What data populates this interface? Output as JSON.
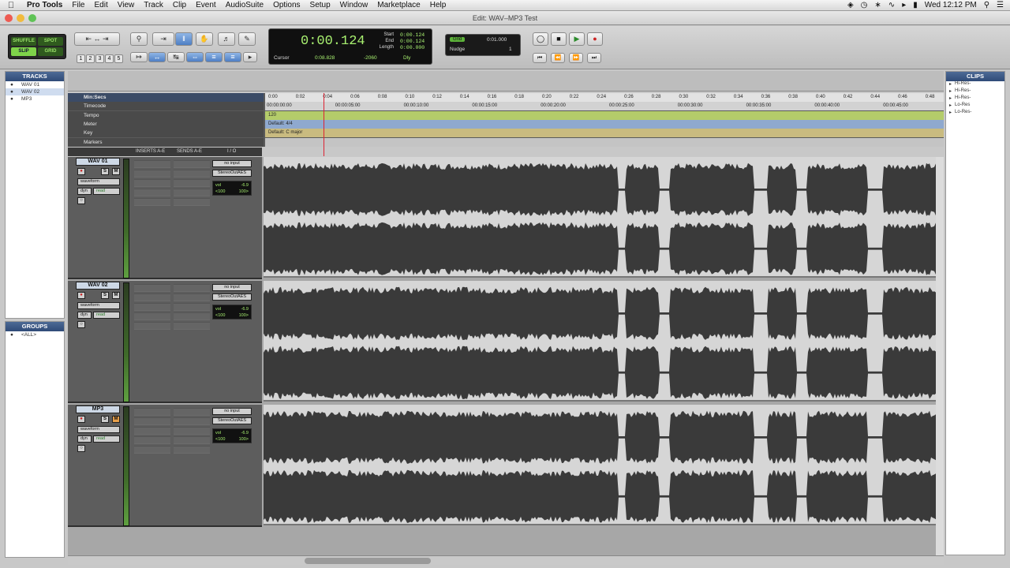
{
  "menubar": {
    "app": "Pro Tools",
    "items": [
      "File",
      "Edit",
      "View",
      "Track",
      "Clip",
      "Event",
      "AudioSuite",
      "Options",
      "Setup",
      "Window",
      "Marketplace",
      "Help"
    ],
    "clock": "Wed 12:12 PM"
  },
  "window": {
    "title": "Edit: WAV–MP3 Test"
  },
  "modes": {
    "shuffle": "SHUFFLE",
    "spot": "SPOT",
    "slip": "SLIP",
    "grid": "GRID"
  },
  "zoom_presets": [
    "1",
    "2",
    "3",
    "4",
    "5"
  ],
  "counter": {
    "main": "0:00.124",
    "start_label": "Start",
    "end_label": "End",
    "length_label": "Length",
    "start": "0:00.124",
    "end": "0:00.124",
    "length": "0:00.000",
    "cursor_label": "Cursor",
    "cursor": "0:08.828",
    "cursor_db": "-2060",
    "dly": "Dly"
  },
  "grid_nudge": {
    "grid_label": "Grid",
    "grid_value": "0:01.000",
    "nudge_label": "Nudge",
    "nudge_value": "1"
  },
  "tracks_panel": {
    "header": "TRACKS",
    "items": [
      {
        "name": "WAV 01"
      },
      {
        "name": "WAV 02"
      },
      {
        "name": "MP3"
      }
    ]
  },
  "groups_panel": {
    "header": "GROUPS",
    "items": [
      {
        "name": "<ALL>"
      }
    ]
  },
  "clips_panel": {
    "header": "CLIPS",
    "items": [
      "Hi-Res-",
      "Hi-Res-",
      "Hi-Res-",
      "Lo-Res",
      "Lo-Res-"
    ]
  },
  "rulers": {
    "minsecs": "Min:Secs",
    "timecode": "Timecode",
    "tempo": "Tempo",
    "meter": "Meter",
    "key": "Key",
    "markers": "Markers",
    "tempo_value": "120",
    "meter_value": "Default: 4/4",
    "key_value": "Default: C major",
    "minsecs_ticks": [
      "0:00",
      "0:02",
      "0:04",
      "0:06",
      "0:08",
      "0:10",
      "0:12",
      "0:14",
      "0:16",
      "0:18",
      "0:20",
      "0:22",
      "0:24",
      "0:26",
      "0:28",
      "0:30",
      "0:32",
      "0:34",
      "0:36",
      "0:38",
      "0:40",
      "0:42",
      "0:44",
      "0:46",
      "0:48"
    ],
    "timecode_ticks": [
      "00:00:00:00",
      "00:00:05:00",
      "00:00:10:00",
      "00:00:15:00",
      "00:00:20:00",
      "00:00:25:00",
      "00:00:30:00",
      "00:00:35:00",
      "00:00:40:00",
      "00:00:45:00"
    ]
  },
  "column_headers": {
    "inserts": "INSERTS A-E",
    "sends": "SENDS A-E",
    "io": "I / O"
  },
  "track_list": [
    {
      "name": "WAV 01",
      "view": "waveform",
      "dyn": "dyn",
      "auto": "read",
      "input": "no input",
      "output": "StereoOutAES",
      "vol_label": "vol",
      "vol": "-6.9",
      "pan_l": "<100",
      "pan_r": "100>"
    },
    {
      "name": "WAV 02",
      "view": "waveform",
      "dyn": "dyn",
      "auto": "read",
      "input": "no input",
      "output": "StereoOutAES",
      "vol_label": "vol",
      "vol": "-6.9",
      "pan_l": "<100",
      "pan_r": "100>"
    },
    {
      "name": "MP3",
      "view": "waveform",
      "dyn": "dyn",
      "auto": "read",
      "input": "no input",
      "output": "StereoOutAES",
      "vol_label": "vol",
      "vol": "-6.9",
      "pan_l": "<100",
      "pan_r": "100>"
    }
  ],
  "colors": {
    "tempo_lane": "#b4cc6a",
    "meter_lane": "#8fa9cf",
    "key_lane": "#c9bb80",
    "wave_fill": "#3a3a3a",
    "wave_bg": "#d6d6d6"
  }
}
